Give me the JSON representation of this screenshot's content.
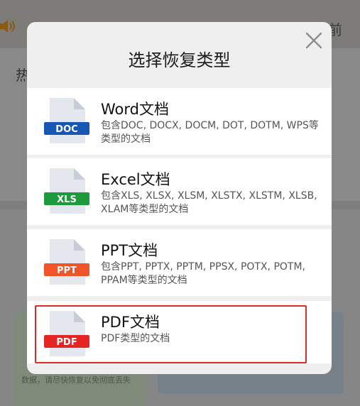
{
  "background": {
    "time_suffix": "前",
    "hot_label": "热",
    "banner_text": "数据，请尽快恢复以免彻底丢失"
  },
  "dialog": {
    "title": "选择恢复类型",
    "options": [
      {
        "badge": "DOC",
        "badge_color": "#1757b3",
        "title": "Word文档",
        "desc": "包含DOC, DOCX, DOCM, DOT, DOTM, WPS等类型的文档"
      },
      {
        "badge": "XLS",
        "badge_color": "#1c9a3c",
        "title": "Excel文档",
        "desc": "包含XLS, XLSX, XLSM, XLSTX, XLSTM, XLSB, XLAM等类型的文档"
      },
      {
        "badge": "PPT",
        "badge_color": "#f0552a",
        "title": "PPT文档",
        "desc": "包含PPT, PPTX, PPTM, PPSX, POTX, POTM, PPAM等类型的文档"
      },
      {
        "badge": "PDF",
        "badge_color": "#e52424",
        "title": "PDF文档",
        "desc": "PDF类型的文档"
      }
    ],
    "highlight_color": "#e02a2a"
  },
  "icons": [
    "speaker-icon",
    "close-icon",
    "doc-file-icon",
    "xls-file-icon",
    "ppt-file-icon",
    "pdf-file-icon"
  ]
}
